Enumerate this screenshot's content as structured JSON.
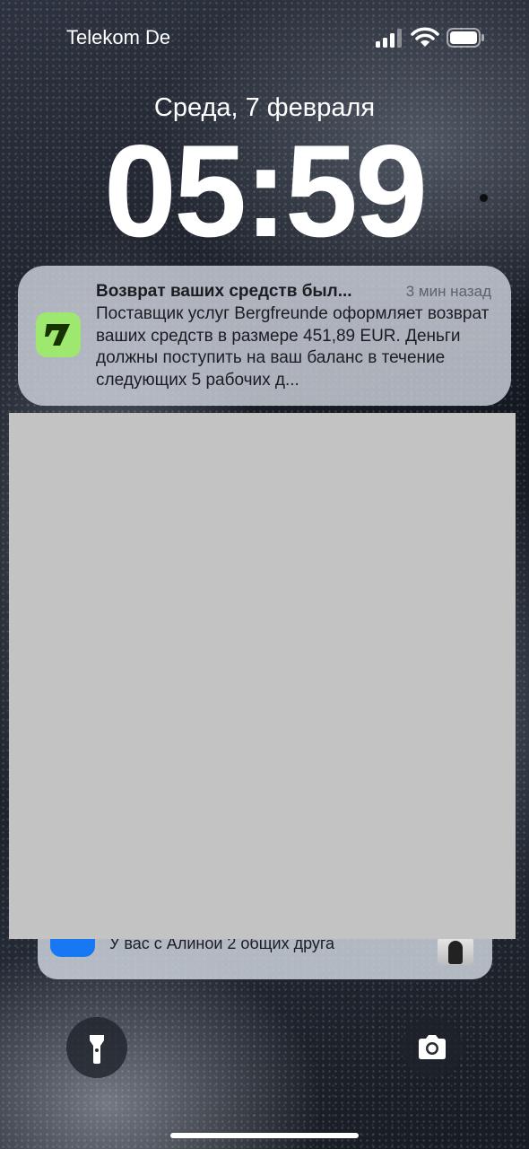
{
  "status_bar": {
    "carrier": "Telekom De",
    "signal_icon": "cellular-signal-icon",
    "wifi_icon": "wifi-icon",
    "battery_icon": "battery-icon"
  },
  "lock_screen": {
    "date": "Среда, 7 февраля",
    "time": "05:59"
  },
  "notification": {
    "app_icon": "wise-app-icon",
    "title": "Возврат ваших средств был...",
    "time_ago": "3 мин назад",
    "body": "Поставщик услуг Bergfreunde оформляет возврат ваших средств в размере 451,89 EUR. Деньги должны поступить на ваш баланс в течение следующих 5 рабочих д...",
    "accent_color": "#9fe870"
  },
  "stacked_notification": {
    "app_icon": "facebook-app-icon",
    "text": "У вас с Алиной 2 общих друга",
    "accent_color": "#1877f2"
  },
  "quick_actions": {
    "flashlight": "flashlight-icon",
    "camera": "camera-icon"
  }
}
